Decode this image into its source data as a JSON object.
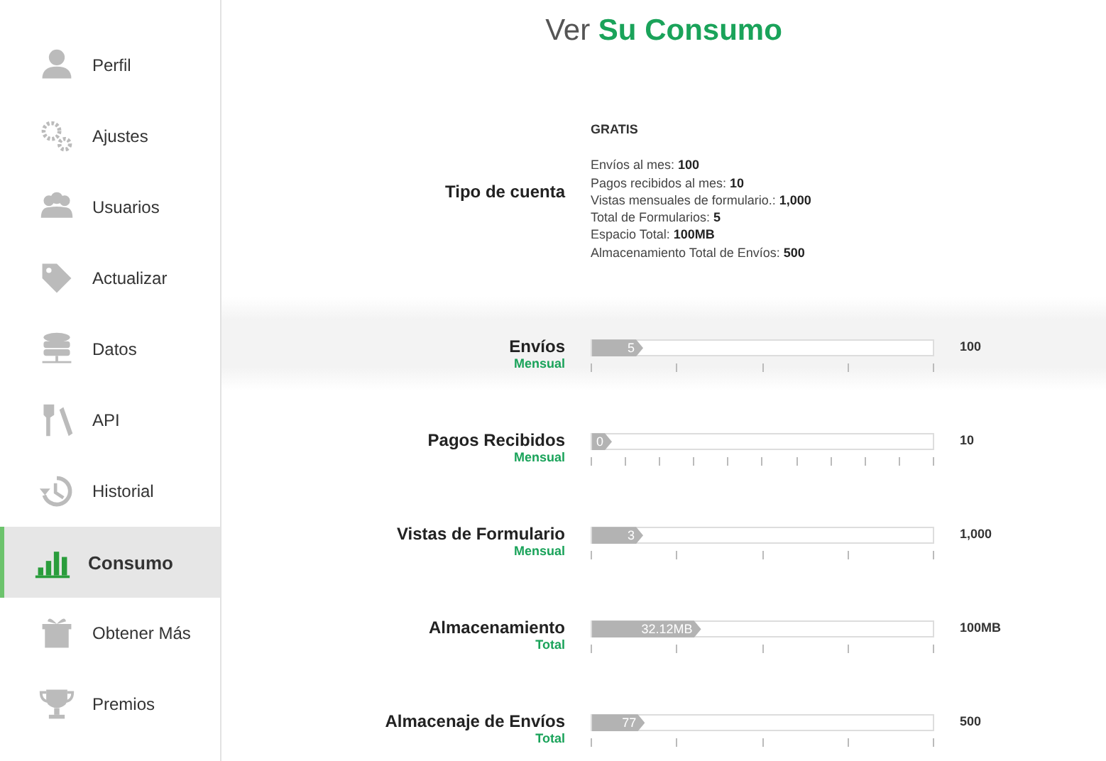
{
  "sidebar": {
    "items": [
      {
        "label": "Perfil",
        "selected": false
      },
      {
        "label": "Ajustes",
        "selected": false
      },
      {
        "label": "Usuarios",
        "selected": false
      },
      {
        "label": "Actualizar",
        "selected": false
      },
      {
        "label": "Datos",
        "selected": false
      },
      {
        "label": "API",
        "selected": false
      },
      {
        "label": "Historial",
        "selected": false
      },
      {
        "label": "Consumo",
        "selected": true
      },
      {
        "label": "Obtener Más",
        "selected": false
      },
      {
        "label": "Premios",
        "selected": false
      }
    ]
  },
  "title": "Ver **Su Consumo**",
  "account": {
    "label": "Tipo de cuenta",
    "plan": "GRATIS",
    "details": [
      {
        "name": "Envíos al mes:",
        "value": "100"
      },
      {
        "name": "Pagos recibidos al mes:",
        "value": "10"
      },
      {
        "name": "Vistas mensuales de formulario.:",
        "value": "1,000"
      },
      {
        "name": "Total de Formularios:",
        "value": "5"
      },
      {
        "name": "Espacio Total:",
        "value": "100MB"
      },
      {
        "name": "Almacenamiento Total de Envíos:",
        "value": "500"
      }
    ]
  },
  "usage": [
    {
      "name": "Envíos",
      "period": "Mensual",
      "used": "5",
      "limit": "100",
      "level": 0.15,
      "kind": "quarters",
      "highlighted": true
    },
    {
      "name": "Pagos Recibidos",
      "period": "Mensual",
      "used": "0",
      "limit": "10",
      "level": 0.04,
      "kind": "tenths",
      "highlighted": false
    },
    {
      "name": "Vistas de Formulario",
      "period": "Mensual",
      "used": "3",
      "limit": "1,000",
      "level": 0.15,
      "kind": "quarters",
      "highlighted": false
    },
    {
      "name": "Almacenamiento",
      "period": "Total",
      "used": "32.12MB",
      "limit": "100MB",
      "level": 0.32,
      "kind": "quarters",
      "highlighted": false
    },
    {
      "name": "Almacenaje de Envíos",
      "period": "Total",
      "used": "77",
      "limit": "500",
      "level": 0.155,
      "kind": "quarters",
      "highlighted": false
    }
  ]
}
